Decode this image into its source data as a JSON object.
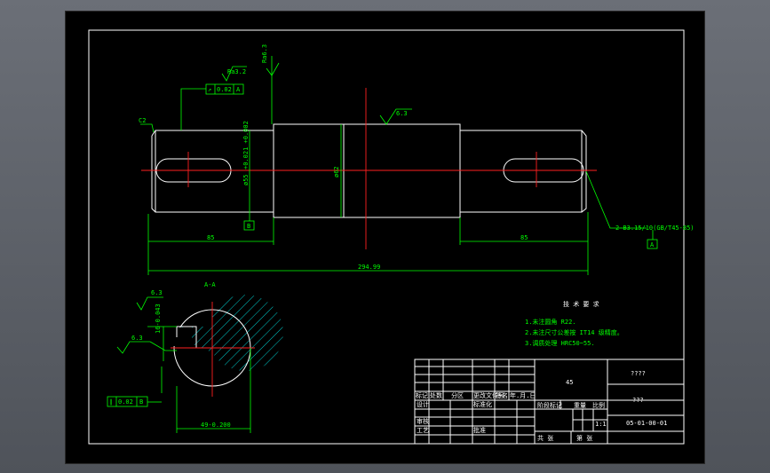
{
  "drawing": {
    "roughness": {
      "top_vertical": "Ra6.3",
      "left_journal": "Ra3.2",
      "middle": "6.3",
      "section_top": "6.3",
      "section_side": "6.3"
    },
    "chamfer": "C2",
    "dims": {
      "left_dia": "ø55",
      "left_dia_tol": "+0.021\n+0.002",
      "mid_dia": "ø62",
      "left_len": "85",
      "right_len": "85",
      "total_len": "294.99",
      "section_depth": "16-0.043",
      "section_width": "49-0.200"
    },
    "datum_b": "B",
    "datum_a": "A",
    "tol_frame_top": {
      "sym": "↗",
      "val": "0.02",
      "ref": "A"
    },
    "tol_frame_section": {
      "sym": "∥",
      "val": "0.02",
      "ref": "B"
    },
    "callout_right": "2-B3.15/10(GB/T45-85)",
    "section_label": "A-A"
  },
  "notes": {
    "title": "技 术 要 求",
    "line1": "1.未注圆角 R22.",
    "line2": "2.未注尺寸公差按 IT14 级精度。",
    "line3": "3.调质处理 HRC50~55."
  },
  "titleblock": {
    "material": "45",
    "name": "????",
    "company": "???",
    "code": "05-01-00-01",
    "scale": "1:1",
    "weight_label": "重量",
    "scale_label": "比例",
    "stage_label": "阶段标记",
    "r_mark": "标记",
    "r_count": "处数",
    "r_zone": "分区",
    "r_doc": "更改文件号",
    "r_sign": "签名",
    "r_date": "年.月.日",
    "design": "设计",
    "standard": "标准化",
    "review": "审核",
    "process": "工艺",
    "approve": "批准",
    "sheet_total": "共  张",
    "sheet_no": "第  张"
  }
}
